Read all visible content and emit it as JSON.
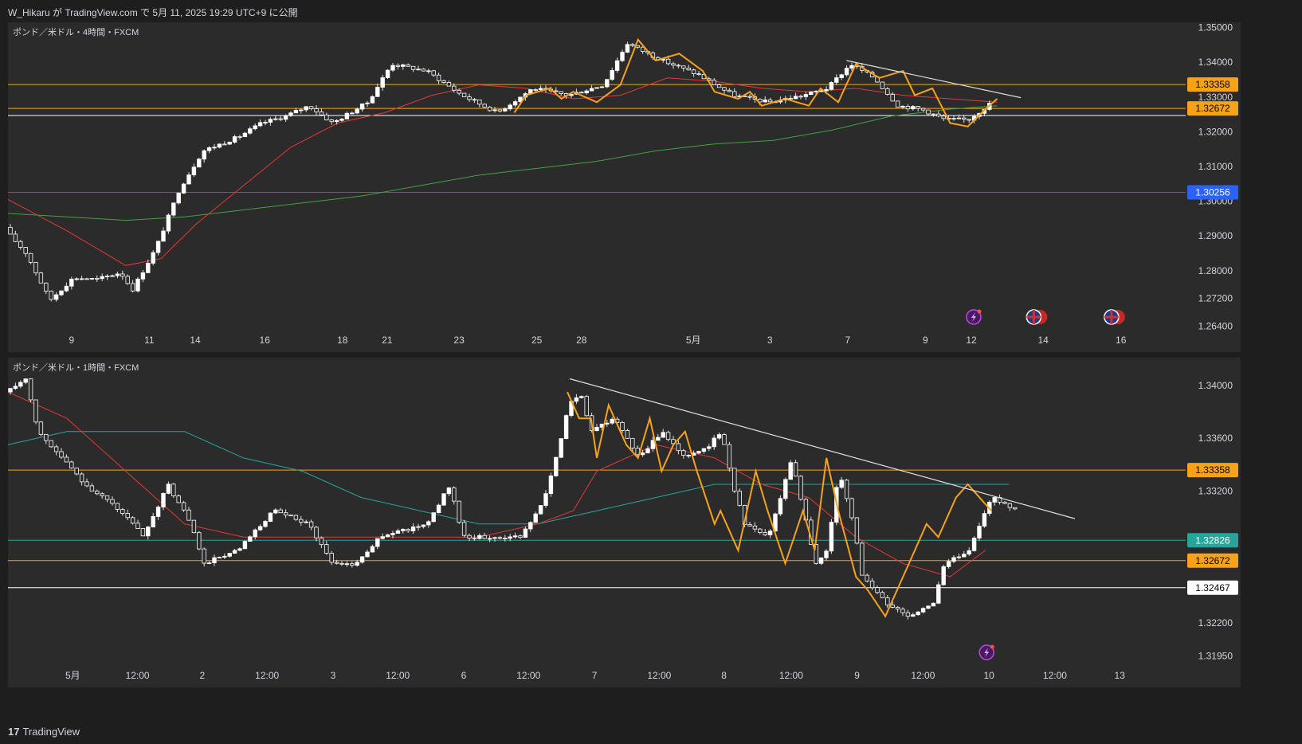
{
  "header": {
    "publish_line": "W_Hikaru が TradingView.com で 5月 11, 2025 19:29 UTC+9 に公開"
  },
  "footer": {
    "brand": "TradingView",
    "logo_glyph": "17"
  },
  "colors": {
    "background": "#2b2b2b",
    "up_candle": "#ffffff",
    "down_candle": "#ffffff",
    "wick": "#e0e0e0",
    "orange": "#f7a21b",
    "red_ma": "#e53935",
    "green_ma": "#43a047",
    "teal_ma": "#26a69a",
    "blue_level": "#2962ff",
    "trendline": "#e0e0e0"
  },
  "chart_data": [
    {
      "type": "candlestick",
      "title": "ポンド／米ドル・4時間・FXCM",
      "ylim": [
        1.263,
        1.3515
      ],
      "y_ticks": [
        "1.35000",
        "1.34000",
        "1.33000",
        "1.32000",
        "1.31000",
        "1.30000",
        "1.29000",
        "1.28000",
        "1.27200",
        "1.26400"
      ],
      "x_ticks": [
        {
          "label": "9",
          "t": 0.054
        },
        {
          "label": "11",
          "t": 0.12
        },
        {
          "label": "14",
          "t": 0.159
        },
        {
          "label": "16",
          "t": 0.218
        },
        {
          "label": "18",
          "t": 0.284
        },
        {
          "label": "21",
          "t": 0.322
        },
        {
          "label": "23",
          "t": 0.383
        },
        {
          "label": "25",
          "t": 0.449
        },
        {
          "label": "28",
          "t": 0.487
        },
        {
          "label": "5月",
          "t": 0.582
        },
        {
          "label": "3",
          "t": 0.647
        },
        {
          "label": "7",
          "t": 0.713
        },
        {
          "label": "9",
          "t": 0.779
        },
        {
          "label": "12",
          "t": 0.818
        },
        {
          "label": "14",
          "t": 0.879
        },
        {
          "label": "16",
          "t": 0.945
        }
      ],
      "price_anchors": [
        [
          0.0,
          1.2925
        ],
        [
          0.02,
          1.285
        ],
        [
          0.04,
          1.2715
        ],
        [
          0.06,
          1.278
        ],
        [
          0.08,
          1.2775
        ],
        [
          0.1,
          1.2795
        ],
        [
          0.11,
          1.2745
        ],
        [
          0.13,
          1.2865
        ],
        [
          0.15,
          1.3035
        ],
        [
          0.17,
          1.3145
        ],
        [
          0.2,
          1.3185
        ],
        [
          0.22,
          1.3225
        ],
        [
          0.24,
          1.3245
        ],
        [
          0.26,
          1.3275
        ],
        [
          0.28,
          1.3225
        ],
        [
          0.31,
          1.3285
        ],
        [
          0.33,
          1.3395
        ],
        [
          0.36,
          1.3375
        ],
        [
          0.39,
          1.3305
        ],
        [
          0.42,
          1.3255
        ],
        [
          0.45,
          1.3325
        ],
        [
          0.48,
          1.3305
        ],
        [
          0.51,
          1.3335
        ],
        [
          0.53,
          1.3455
        ],
        [
          0.56,
          1.3405
        ],
        [
          0.59,
          1.3365
        ],
        [
          0.62,
          1.3305
        ],
        [
          0.65,
          1.3285
        ],
        [
          0.68,
          1.3305
        ],
        [
          0.7,
          1.3325
        ],
        [
          0.72,
          1.3395
        ],
        [
          0.74,
          1.3355
        ],
        [
          0.76,
          1.3275
        ],
        [
          0.78,
          1.3265
        ],
        [
          0.8,
          1.3235
        ],
        [
          0.82,
          1.3235
        ],
        [
          0.84,
          1.3285
        ]
      ],
      "red_ma": [
        [
          0.0,
          1.3005
        ],
        [
          0.05,
          1.2915
        ],
        [
          0.1,
          1.2815
        ],
        [
          0.13,
          1.2835
        ],
        [
          0.16,
          1.2935
        ],
        [
          0.2,
          1.3045
        ],
        [
          0.24,
          1.3155
        ],
        [
          0.28,
          1.3225
        ],
        [
          0.32,
          1.3255
        ],
        [
          0.36,
          1.3305
        ],
        [
          0.4,
          1.3335
        ],
        [
          0.44,
          1.3325
        ],
        [
          0.48,
          1.3295
        ],
        [
          0.52,
          1.3305
        ],
        [
          0.56,
          1.3355
        ],
        [
          0.6,
          1.3345
        ],
        [
          0.64,
          1.3325
        ],
        [
          0.68,
          1.3315
        ],
        [
          0.72,
          1.3325
        ],
        [
          0.76,
          1.3305
        ],
        [
          0.8,
          1.3295
        ],
        [
          0.84,
          1.3285
        ]
      ],
      "green_ma": [
        [
          0.0,
          1.2965
        ],
        [
          0.05,
          1.2955
        ],
        [
          0.1,
          1.2945
        ],
        [
          0.15,
          1.2955
        ],
        [
          0.2,
          1.2975
        ],
        [
          0.25,
          1.2995
        ],
        [
          0.3,
          1.3015
        ],
        [
          0.35,
          1.3045
        ],
        [
          0.4,
          1.3075
        ],
        [
          0.45,
          1.3095
        ],
        [
          0.5,
          1.3115
        ],
        [
          0.55,
          1.3145
        ],
        [
          0.6,
          1.3165
        ],
        [
          0.65,
          1.3175
        ],
        [
          0.7,
          1.3205
        ],
        [
          0.75,
          1.3245
        ],
        [
          0.8,
          1.3265
        ],
        [
          0.84,
          1.3275
        ]
      ],
      "orange_zigzag": [
        [
          0.43,
          1.3255
        ],
        [
          0.44,
          1.3305
        ],
        [
          0.46,
          1.3325
        ],
        [
          0.47,
          1.3295
        ],
        [
          0.48,
          1.3315
        ],
        [
          0.5,
          1.3285
        ],
        [
          0.52,
          1.3335
        ],
        [
          0.535,
          1.3465
        ],
        [
          0.55,
          1.3405
        ],
        [
          0.57,
          1.3425
        ],
        [
          0.59,
          1.3375
        ],
        [
          0.6,
          1.3315
        ],
        [
          0.62,
          1.3295
        ],
        [
          0.63,
          1.3315
        ],
        [
          0.64,
          1.3275
        ],
        [
          0.66,
          1.3295
        ],
        [
          0.68,
          1.3275
        ],
        [
          0.69,
          1.3325
        ],
        [
          0.705,
          1.3285
        ],
        [
          0.72,
          1.3395
        ],
        [
          0.74,
          1.3355
        ],
        [
          0.76,
          1.3375
        ],
        [
          0.77,
          1.3305
        ],
        [
          0.785,
          1.3325
        ],
        [
          0.8,
          1.3225
        ],
        [
          0.815,
          1.3215
        ],
        [
          0.83,
          1.3265
        ],
        [
          0.84,
          1.3295
        ]
      ],
      "trendline": [
        [
          0.712,
          1.3405
        ],
        [
          0.86,
          1.3298
        ]
      ],
      "levels": [
        {
          "price": 1.33358,
          "label": "1.33358",
          "kind": "orange"
        },
        {
          "price": 1.32672,
          "label": "1.32672",
          "kind": "orange"
        },
        {
          "price": 1.32467,
          "label": "1.32467",
          "kind": "white",
          "badge": false
        },
        {
          "price": 1.30256,
          "label": "1.30256",
          "kind": "blue"
        }
      ],
      "event_icons": [
        {
          "t": 0.82,
          "name": "lightning-event-icon"
        },
        {
          "t": 0.871,
          "name": "uk-flag-event-icon"
        },
        {
          "t": 0.937,
          "name": "uk-flag-event-icon"
        }
      ]
    },
    {
      "type": "candlestick",
      "title": "ポンド／米ドル・1時間・FXCM",
      "ylim": [
        1.3188,
        1.3421
      ],
      "y_ticks": [
        "1.34000",
        "1.33600",
        "1.33200",
        "1.32200",
        "1.31950"
      ],
      "x_ticks": [
        {
          "label": "5月",
          "t": 0.055
        },
        {
          "label": "12:00",
          "t": 0.11
        },
        {
          "label": "2",
          "t": 0.165
        },
        {
          "label": "12:00",
          "t": 0.22
        },
        {
          "label": "3",
          "t": 0.276
        },
        {
          "label": "12:00",
          "t": 0.331
        },
        {
          "label": "6",
          "t": 0.387
        },
        {
          "label": "12:00",
          "t": 0.442
        },
        {
          "label": "7",
          "t": 0.498
        },
        {
          "label": "12:00",
          "t": 0.553
        },
        {
          "label": "8",
          "t": 0.608
        },
        {
          "label": "12:00",
          "t": 0.665
        },
        {
          "label": "9",
          "t": 0.721
        },
        {
          "label": "12:00",
          "t": 0.777
        },
        {
          "label": "10",
          "t": 0.833
        },
        {
          "label": "12:00",
          "t": 0.889
        },
        {
          "label": "13",
          "t": 0.944
        }
      ],
      "price_anchors": [
        [
          0.0,
          1.3395
        ],
        [
          0.02,
          1.3405
        ],
        [
          0.03,
          1.3365
        ],
        [
          0.05,
          1.3345
        ],
        [
          0.07,
          1.3325
        ],
        [
          0.1,
          1.3305
        ],
        [
          0.12,
          1.3285
        ],
        [
          0.14,
          1.3325
        ],
        [
          0.16,
          1.3295
        ],
        [
          0.17,
          1.3265
        ],
        [
          0.2,
          1.3275
        ],
        [
          0.23,
          1.3305
        ],
        [
          0.26,
          1.3295
        ],
        [
          0.28,
          1.3265
        ],
        [
          0.3,
          1.3265
        ],
        [
          0.32,
          1.3285
        ],
        [
          0.36,
          1.3295
        ],
        [
          0.38,
          1.3325
        ],
        [
          0.39,
          1.3285
        ],
        [
          0.41,
          1.3285
        ],
        [
          0.43,
          1.3285
        ],
        [
          0.44,
          1.3285
        ],
        [
          0.46,
          1.3315
        ],
        [
          0.47,
          1.3345
        ],
        [
          0.48,
          1.3385
        ],
        [
          0.49,
          1.3395
        ],
        [
          0.5,
          1.3365
        ],
        [
          0.52,
          1.3375
        ],
        [
          0.54,
          1.3345
        ],
        [
          0.56,
          1.3365
        ],
        [
          0.58,
          1.3345
        ],
        [
          0.6,
          1.3355
        ],
        [
          0.61,
          1.3365
        ],
        [
          0.62,
          1.3325
        ],
        [
          0.63,
          1.3295
        ],
        [
          0.65,
          1.3285
        ],
        [
          0.67,
          1.3345
        ],
        [
          0.68,
          1.3305
        ],
        [
          0.69,
          1.3265
        ],
        [
          0.7,
          1.3275
        ],
        [
          0.71,
          1.3335
        ],
        [
          0.72,
          1.3305
        ],
        [
          0.73,
          1.3255
        ],
        [
          0.75,
          1.3235
        ],
        [
          0.77,
          1.3225
        ],
        [
          0.79,
          1.3235
        ],
        [
          0.8,
          1.3265
        ],
        [
          0.82,
          1.3275
        ],
        [
          0.84,
          1.3315
        ],
        [
          0.86,
          1.3305
        ]
      ],
      "red_ma": [
        [
          0.0,
          1.3395
        ],
        [
          0.05,
          1.3375
        ],
        [
          0.1,
          1.3335
        ],
        [
          0.15,
          1.3295
        ],
        [
          0.2,
          1.3285
        ],
        [
          0.25,
          1.3285
        ],
        [
          0.3,
          1.3285
        ],
        [
          0.35,
          1.3285
        ],
        [
          0.4,
          1.3285
        ],
        [
          0.45,
          1.3295
        ],
        [
          0.48,
          1.3305
        ],
        [
          0.5,
          1.3335
        ],
        [
          0.55,
          1.3355
        ],
        [
          0.6,
          1.3345
        ],
        [
          0.64,
          1.3325
        ],
        [
          0.68,
          1.3315
        ],
        [
          0.72,
          1.3285
        ],
        [
          0.76,
          1.3265
        ],
        [
          0.8,
          1.3255
        ],
        [
          0.83,
          1.3275
        ]
      ],
      "teal_ma": [
        [
          0.0,
          1.3355
        ],
        [
          0.05,
          1.3365
        ],
        [
          0.1,
          1.3365
        ],
        [
          0.15,
          1.3365
        ],
        [
          0.2,
          1.3345
        ],
        [
          0.25,
          1.3335
        ],
        [
          0.3,
          1.3315
        ],
        [
          0.35,
          1.3305
        ],
        [
          0.4,
          1.3295
        ],
        [
          0.45,
          1.3295
        ],
        [
          0.5,
          1.3305
        ],
        [
          0.55,
          1.3315
        ],
        [
          0.6,
          1.3325
        ],
        [
          0.65,
          1.3325
        ],
        [
          0.7,
          1.3325
        ],
        [
          0.75,
          1.3325
        ],
        [
          0.8,
          1.3325
        ],
        [
          0.85,
          1.3325
        ]
      ],
      "orange_zigzag": [
        [
          0.475,
          1.3395
        ],
        [
          0.485,
          1.3375
        ],
        [
          0.495,
          1.3375
        ],
        [
          0.5,
          1.3345
        ],
        [
          0.51,
          1.3385
        ],
        [
          0.525,
          1.3355
        ],
        [
          0.535,
          1.3345
        ],
        [
          0.545,
          1.3375
        ],
        [
          0.555,
          1.3335
        ],
        [
          0.565,
          1.3355
        ],
        [
          0.575,
          1.3365
        ],
        [
          0.585,
          1.3335
        ],
        [
          0.6,
          1.3295
        ],
        [
          0.605,
          1.3305
        ],
        [
          0.62,
          1.3275
        ],
        [
          0.635,
          1.3335
        ],
        [
          0.645,
          1.3305
        ],
        [
          0.66,
          1.3265
        ],
        [
          0.675,
          1.3305
        ],
        [
          0.685,
          1.3275
        ],
        [
          0.695,
          1.3345
        ],
        [
          0.705,
          1.3305
        ],
        [
          0.72,
          1.3255
        ],
        [
          0.73,
          1.3245
        ],
        [
          0.745,
          1.3225
        ],
        [
          0.755,
          1.3245
        ],
        [
          0.77,
          1.3275
        ],
        [
          0.78,
          1.3295
        ],
        [
          0.79,
          1.3285
        ],
        [
          0.805,
          1.3315
        ],
        [
          0.815,
          1.3325
        ],
        [
          0.825,
          1.3315
        ],
        [
          0.835,
          1.3305
        ]
      ],
      "trendline": [
        [
          0.477,
          1.3405
        ],
        [
          0.906,
          1.3299
        ]
      ],
      "levels": [
        {
          "price": 1.33358,
          "label": "1.33358",
          "kind": "orange"
        },
        {
          "price": 1.32826,
          "label": "1.32826",
          "kind": "teal"
        },
        {
          "price": 1.32672,
          "label": "1.32672",
          "kind": "orange"
        },
        {
          "price": 1.32467,
          "label": "1.32467",
          "kind": "white"
        }
      ],
      "event_icons": [
        {
          "t": 0.831,
          "name": "lightning-event-icon"
        }
      ]
    }
  ]
}
